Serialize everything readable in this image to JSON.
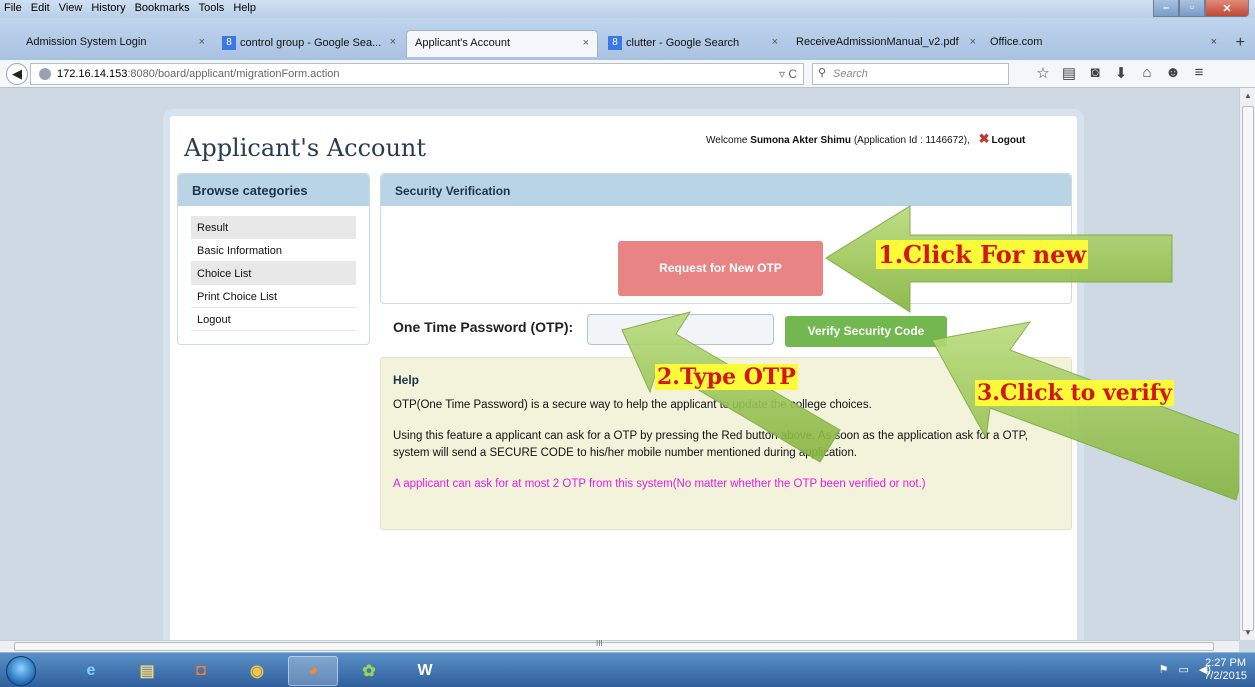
{
  "menu": [
    "File",
    "Edit",
    "View",
    "History",
    "Bookmarks",
    "Tools",
    "Help"
  ],
  "tabs": [
    {
      "label": "Admission System Login"
    },
    {
      "label": "control group - Google Sea..."
    },
    {
      "label": "Applicant's Account"
    },
    {
      "label": "clutter - Google Search"
    },
    {
      "label": "ReceiveAdmissionManual_v2.pdf"
    },
    {
      "label": "Office.com"
    }
  ],
  "url": {
    "host": "172.16.14.153",
    "path": ":8080/board/applicant/migrationForm.action"
  },
  "search": {
    "placeholder": "Search"
  },
  "page": {
    "title": "Applicant's Account",
    "welcome_prefix": "Welcome ",
    "user_name": "Sumona Akter Shimu",
    "app_id_text": " (Application Id : 1146672),",
    "logout": "Logout"
  },
  "sidebar": {
    "heading": "Browse categories",
    "items": [
      {
        "label": "Result"
      },
      {
        "label": "Basic Information"
      },
      {
        "label": "Choice List"
      },
      {
        "label": "Print Choice List"
      },
      {
        "label": "Logout"
      }
    ]
  },
  "security": {
    "heading": "Security Verification",
    "request_button": "Request for New OTP",
    "otp_label": "One Time Password (OTP):",
    "otp_value": "",
    "verify_button": "Verify Security Code"
  },
  "help": {
    "heading": "Help",
    "p1": "OTP(One Time Password) is a secure way to help the applicant to update the college choices.",
    "p2": "Using this feature a applicant can ask for a OTP by pressing the Red button above. As soon as the application ask for a OTP, system will send a SECURE CODE to his/her mobile number mentioned during application.",
    "note": "A applicant can ask for at most 2 OTP from this system(No matter whether the OTP been verified or not.)"
  },
  "annotations": {
    "a1": "1.Click For new",
    "a2": "2.Type OTP",
    "a3": "3.Click to verify"
  },
  "taskbar": {
    "time": "2:27 PM",
    "date": "7/2/2015"
  },
  "colors": {
    "accent_header": "#b9d4e4",
    "otp_button": "#e88584",
    "verify_button": "#72b74f",
    "note_text": "#e11ee1",
    "arrow_fill": "#9cc45a"
  }
}
